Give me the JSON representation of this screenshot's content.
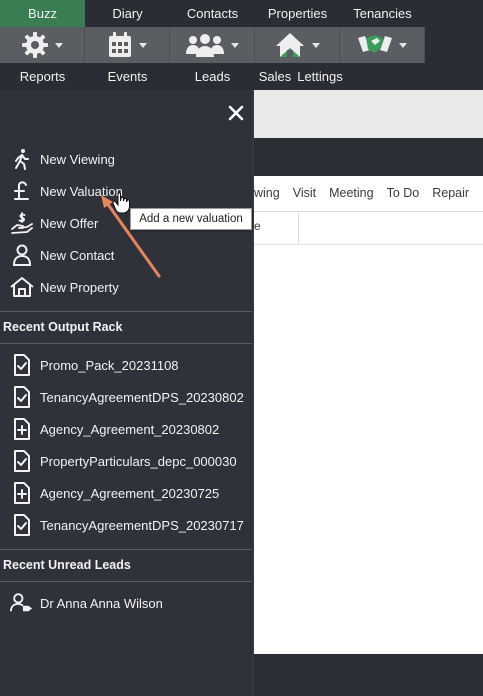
{
  "nav": {
    "top_tabs": [
      "Buzz",
      "Diary",
      "Contacts",
      "Properties",
      "Tenancies"
    ],
    "labels": [
      "Reports",
      "Events",
      "Leads",
      "Sales",
      "Lettings"
    ],
    "icons": [
      "gear-icon",
      "calendar-icon",
      "people-icon",
      "house-icon",
      "handshake-icon"
    ]
  },
  "background": {
    "tabs": [
      "wing",
      "Visit",
      "Meeting",
      "To Do",
      "Repair"
    ],
    "column_fragment": "e"
  },
  "panel": {
    "actions": [
      {
        "label": "New Viewing",
        "icon": "walking-person-icon"
      },
      {
        "label": "New Valuation",
        "icon": "pound-icon"
      },
      {
        "label": "New Offer",
        "icon": "offer-hand-icon"
      },
      {
        "label": "New Contact",
        "icon": "person-icon"
      },
      {
        "label": "New Property",
        "icon": "house-outline-icon"
      }
    ],
    "recent_output_title": "Recent Output Rack",
    "recent_output": [
      {
        "label": "Promo_Pack_20231108",
        "icon": "doc-check-icon"
      },
      {
        "label": "TenancyAgreementDPS_20230802",
        "icon": "doc-check-icon"
      },
      {
        "label": "Agency_Agreement_20230802",
        "icon": "doc-plus-icon"
      },
      {
        "label": "PropertyParticulars_depc_000030",
        "icon": "doc-check-icon"
      },
      {
        "label": "Agency_Agreement_20230725",
        "icon": "doc-plus-icon"
      },
      {
        "label": "TenancyAgreementDPS_20230717",
        "icon": "doc-check-icon"
      }
    ],
    "recent_leads_title": "Recent Unread Leads",
    "recent_leads": [
      {
        "label": "Dr Anna Anna Wilson",
        "icon": "person-tag-icon"
      }
    ]
  },
  "tooltip": "Add a new valuation",
  "colors": {
    "active_tab": "#3a7d52",
    "arrow": "#e8835a"
  }
}
